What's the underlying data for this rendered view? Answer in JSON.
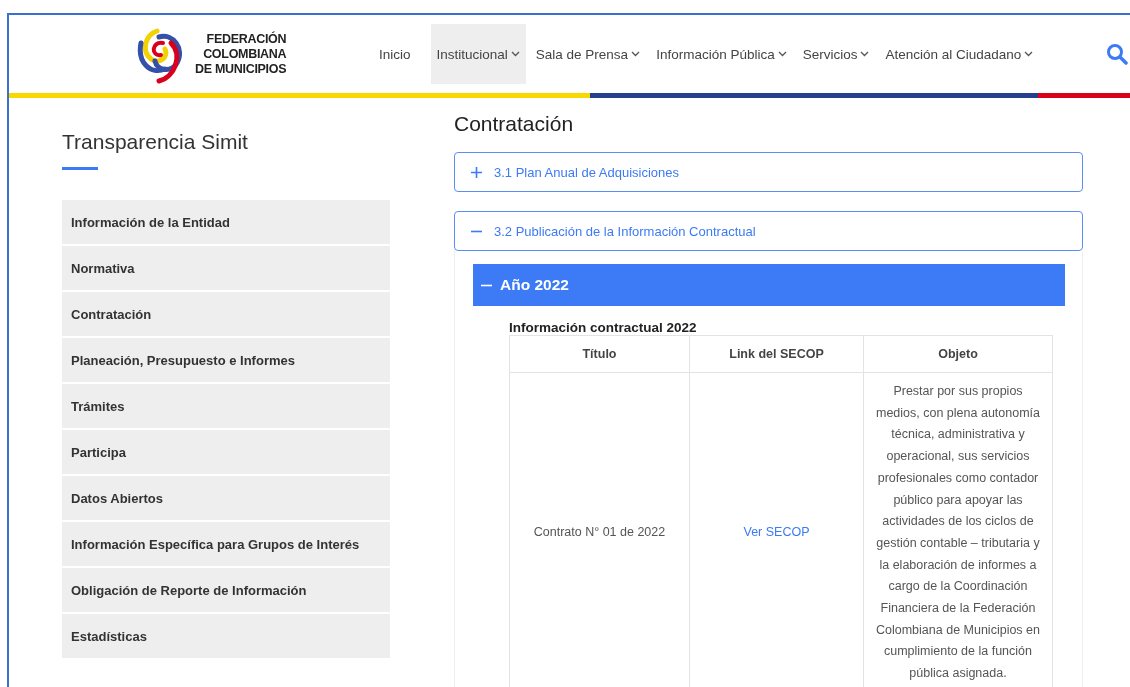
{
  "logo": {
    "lines": [
      "FEDERACIÓN",
      "COLOMBIANA",
      "DE MUNICIPIOS"
    ]
  },
  "nav": [
    {
      "label": "Inicio",
      "dropdown": false,
      "selected": false
    },
    {
      "label": "Institucional",
      "dropdown": true,
      "selected": true
    },
    {
      "label": "Sala de Prensa",
      "dropdown": true,
      "selected": false
    },
    {
      "label": "Información Pública",
      "dropdown": true,
      "selected": false
    },
    {
      "label": "Servicios",
      "dropdown": true,
      "selected": false
    },
    {
      "label": "Atención al Ciudadano",
      "dropdown": true,
      "selected": false
    }
  ],
  "sidebar": {
    "title": "Transparencia Simit",
    "items": [
      "Información de la Entidad",
      "Normativa",
      "Contratación",
      "Planeación, Presupuesto e Informes",
      "Trámites",
      "Participa",
      "Datos Abiertos",
      "Información Específica para Grupos de Interés",
      "Obligación de Reporte de Información",
      "Estadísticas"
    ]
  },
  "content": {
    "title": "Contratación",
    "accordions": [
      {
        "label": "3.1 Plan Anual de Adquisiciones",
        "expanded": false
      },
      {
        "label": "3.2 Publicación de la Información Contractual",
        "expanded": true,
        "year": {
          "label": "Año 2022",
          "expanded": true,
          "table_title": "Información contractual 2022",
          "table": {
            "columns": [
              "Título",
              "Link del SECOP",
              "Objeto"
            ],
            "rows": [
              {
                "title": "Contrato N° 01 de 2022",
                "link": "Ver SECOP",
                "object": "Prestar por sus propios medios, con plena autonomía técnica, administrativa y operacional, sus servicios profesionales como contador público para apoyar las actividades de los ciclos de gestión contable – tributaria y la elaboración de informes a cargo de la Coordinación Financiera de la Federación Colombiana de Municipios en cumplimiento de la función pública asignada."
              }
            ]
          }
        }
      }
    ]
  }
}
